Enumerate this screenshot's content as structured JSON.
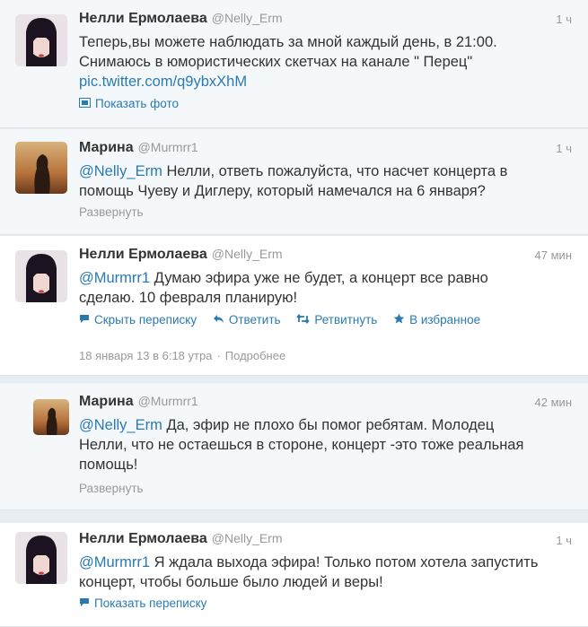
{
  "tweets": [
    {
      "name": "Нелли Ермолаева",
      "handle": "@Nelly_Erm",
      "time": "1 ч",
      "line1": "Теперь,вы можете наблюдать за мной каждый день, в 21:00.",
      "line2": "Снимаюсь в юмористических скетчах на канале \" Перец\"",
      "link": "pic.twitter.com/q9ybxXhM",
      "action": "Показать фото"
    },
    {
      "name": "Марина",
      "handle": "@Murmrr1",
      "time": "1 ч",
      "mention": "@Nelly_Erm",
      "line1": "Нелли, ответь пожалуйста, что насчет концерта в",
      "line2": "помощь Чуеву и Диглеру, который намечался на 6 января?",
      "action": "Развернуть"
    },
    {
      "name": "Нелли Ермолаева",
      "handle": "@Nelly_Erm",
      "time": "47 мин",
      "mention": "@Murmrr1",
      "line1": "Думаю эфира уже не будет, а концерт все равно",
      "line2": "сделаю. 10 февраля планирую!",
      "actions": {
        "hide": "Скрыть переписку",
        "reply": "Ответить",
        "retweet": "Ретвитнуть",
        "favorite": "В избранное"
      },
      "date": "18 января 13 в 6:18 утра",
      "dot": "·",
      "details": "Подробнее"
    },
    {
      "name": "Марина",
      "handle": "@Murmrr1",
      "time": "42 мин",
      "mention": "@Nelly_Erm",
      "line1": "Да, эфир не плохо бы помог ребятам. Молодец",
      "line2": "Нелли, что не остаешься в стороне, концерт -это тоже реальная",
      "line3": "помощь!",
      "action": "Развернуть"
    },
    {
      "name": "Нелли Ермолаева",
      "handle": "@Nelly_Erm",
      "time": "1 ч",
      "mention": "@Murmrr1",
      "line1": "Я ждала выхода эфира! Только потом хотела запустить",
      "line2": "концерт, чтобы больше было людей и веры!",
      "action": "Показать переписку"
    }
  ],
  "icons": {
    "photo": "photo-icon",
    "conversation": "speech-bubble-icon",
    "reply": "reply-arrow-icon",
    "retweet": "retweet-icon",
    "favorite": "star-icon"
  },
  "colors": {
    "link": "#2a7ab2",
    "muted": "#999999",
    "text": "#333333"
  }
}
